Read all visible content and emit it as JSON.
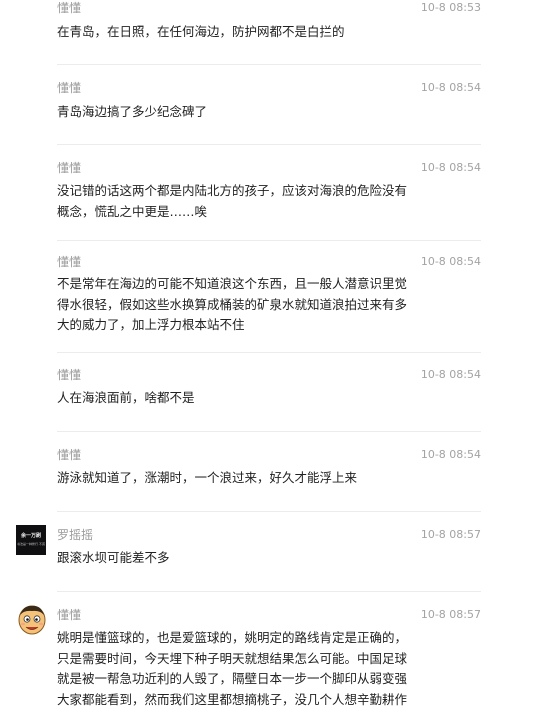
{
  "comments": [
    {
      "author": "懂懂",
      "time": "10-8 08:53",
      "text": "在青岛，在日照，在任何海边，防护网都不是白拦的"
    },
    {
      "author": "懂懂",
      "time": "10-8 08:54",
      "text": "青岛海边搞了多少纪念碑了"
    },
    {
      "author": "懂懂",
      "time": "10-8 08:54",
      "text": "没记错的话这两个都是内陆北方的孩子，应该对海浪的危险没有\n概念，慌乱之中更是……唉"
    },
    {
      "author": "懂懂",
      "time": "10-8 08:54",
      "text": "不是常年在海边的可能不知道浪这个东西，且一般人潜意识里觉\n得水很轻，假如这些水换算成桶装的矿泉水就知道浪拍过来有多\n大的威力了，加上浮力根本站不住"
    },
    {
      "author": "懂懂",
      "time": "10-8 08:54",
      "text": "人在海浪面前，啥都不是"
    },
    {
      "author": "懂懂",
      "time": "10-8 08:54",
      "text": "游泳就知道了，涨潮时，一个浪过来，好久才能浮上来"
    },
    {
      "author": "罗摇摇",
      "time": "10-8 08:57",
      "text": "跟滚水坝可能差不多",
      "avatar_text": "余一万刷",
      "avatar_subtext": "书法是一种修行·不惑"
    },
    {
      "author": "懂懂",
      "time": "10-8 08:57",
      "text": "姚明是懂篮球的，也是爱篮球的，姚明定的路线肯定是正确的，\n只是需要时间，今天埋下种子明天就想结果怎么可能。中国足球\n就是被一帮急功近利的人毁了，隔壁日本一步一个脚印从弱变强\n大家都能看到，然而我们这里都想摘桃子，没几个人想辛勤耕作"
    }
  ]
}
